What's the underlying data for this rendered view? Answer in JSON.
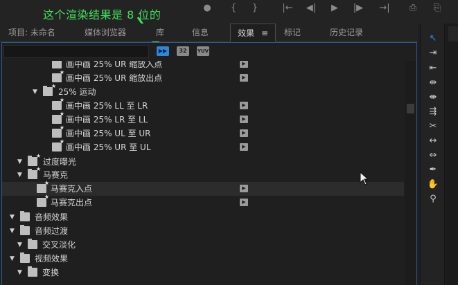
{
  "annotation": {
    "text": "这个渲染结果是 8 位的",
    "color": "#3fe05a"
  },
  "transport": [
    "●",
    "{",
    "}",
    "|←",
    "◀|",
    "▶",
    "|▶",
    "→|",
    "⎙",
    "⎘"
  ],
  "tabs": [
    {
      "label": "项目: 未命名",
      "active": false
    },
    {
      "label": "媒体浏览器",
      "active": false
    },
    {
      "label": "库",
      "active": false
    },
    {
      "label": "信息",
      "active": false
    },
    {
      "label": "效果",
      "active": true,
      "menu": "≡"
    },
    {
      "label": "标记",
      "active": false
    },
    {
      "label": "历史记录",
      "active": false
    }
  ],
  "search": {
    "value": "",
    "placeholder": ""
  },
  "filters": {
    "accelerated": "▶▶",
    "bit32": "32",
    "yuv": "YUV"
  },
  "tree": [
    {
      "label": "画中画 25% UR 缩放入点",
      "type": "effect",
      "badge": true
    },
    {
      "label": "画中画 25% UR 缩放出点",
      "type": "effect",
      "badge": true
    },
    {
      "label": "25% 运动",
      "type": "folder-star",
      "expanded": true
    },
    {
      "label": "画中画 25% LL 至 LR",
      "type": "effect",
      "badge": true
    },
    {
      "label": "画中画 25% LR 至 LL",
      "type": "effect",
      "badge": true
    },
    {
      "label": "画中画 25% UL 至 UR",
      "type": "effect",
      "badge": true
    },
    {
      "label": "画中画 25% UR 至 UL",
      "type": "effect",
      "badge": true
    },
    {
      "label": "过度曝光",
      "type": "folder-star",
      "expanded": true
    },
    {
      "label": "马赛克",
      "type": "folder-star",
      "expanded": true
    },
    {
      "label": "马赛克入点",
      "type": "effect",
      "badge": true,
      "highlight": true
    },
    {
      "label": "马赛克出点",
      "type": "effect",
      "badge": true
    },
    {
      "label": "音频效果",
      "type": "folder",
      "expanded": true
    },
    {
      "label": "音频过渡",
      "type": "folder",
      "expanded": true
    },
    {
      "label": "交叉淡化",
      "type": "folder",
      "expanded": true
    },
    {
      "label": "视频效果",
      "type": "folder",
      "expanded": true
    },
    {
      "label": "变换",
      "type": "folder",
      "expanded": true
    }
  ],
  "tools": [
    {
      "name": "selection-tool",
      "glyph": "↖",
      "active": true
    },
    {
      "name": "track-select-forward-tool",
      "glyph": "⇥"
    },
    {
      "name": "track-select-backward-tool",
      "glyph": "⇤"
    },
    {
      "name": "ripple-edit-tool",
      "glyph": "⇹"
    },
    {
      "name": "rolling-edit-tool",
      "glyph": "⇼"
    },
    {
      "name": "rate-stretch-tool",
      "glyph": "⇶"
    },
    {
      "name": "razor-tool",
      "glyph": "✂"
    },
    {
      "name": "slip-tool",
      "glyph": "↔"
    },
    {
      "name": "slide-tool",
      "glyph": "⇔"
    },
    {
      "name": "pen-tool",
      "glyph": "✒"
    },
    {
      "name": "hand-tool",
      "glyph": "✋"
    },
    {
      "name": "zoom-tool",
      "glyph": "⚲"
    }
  ],
  "colors": {
    "accent": "#2f87d8",
    "panel_border": "#2b5d9a",
    "background": "#1f1f1f"
  }
}
